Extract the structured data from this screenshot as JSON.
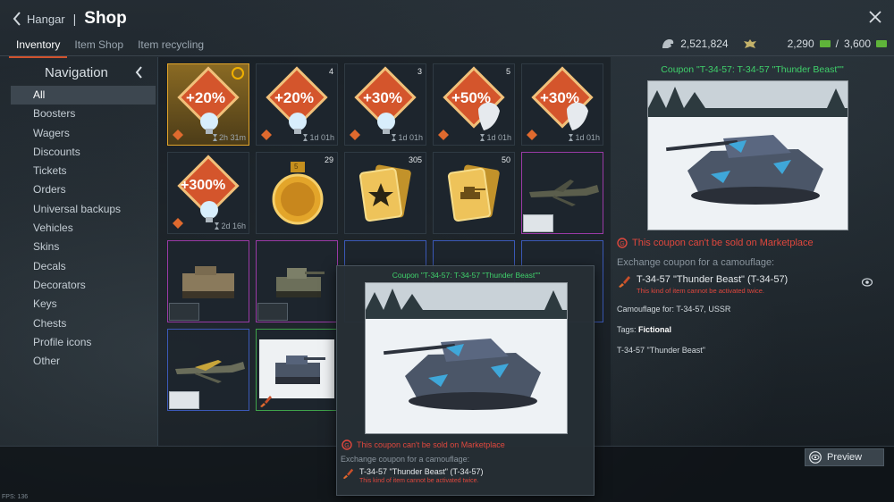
{
  "header": {
    "back_label": "Hangar",
    "separator": "|",
    "title": "Shop",
    "tabs": [
      "Inventory",
      "Item Shop",
      "Item recycling"
    ],
    "active_tab": "Inventory",
    "currency": {
      "silver_lions": "2,521,824",
      "golden_eagles": "2,290",
      "ge_sep": "/",
      "ge_total": "3,600"
    }
  },
  "nav": {
    "title": "Navigation",
    "items": [
      "All",
      "Boosters",
      "Wagers",
      "Discounts",
      "Tickets",
      "Orders",
      "Universal backups",
      "Vehicles",
      "Skins",
      "Decals",
      "Decorators",
      "Keys",
      "Chests",
      "Profile icons",
      "Other"
    ],
    "active": "All"
  },
  "grid": {
    "cells": [
      {
        "kind": "booster",
        "label": "+20%",
        "timer": "2h 31m",
        "count": ""
      },
      {
        "kind": "booster",
        "label": "+20%",
        "timer": "1d 01h",
        "count": "4"
      },
      {
        "kind": "booster",
        "label": "+30%",
        "timer": "1d 01h",
        "count": "3"
      },
      {
        "kind": "booster",
        "label": "+50%",
        "timer": "1d 01h",
        "count": "5"
      },
      {
        "kind": "booster",
        "label": "+30%",
        "timer": "1d 01h",
        "count": ""
      },
      {
        "kind": "booster",
        "label": "+300%",
        "timer": "2d 16h",
        "count": ""
      },
      {
        "kind": "medal",
        "label": "",
        "timer": "",
        "count": "29",
        "medal_number": "5"
      },
      {
        "kind": "card-star",
        "label": "",
        "timer": "",
        "count": "305"
      },
      {
        "kind": "card-tank",
        "label": "",
        "timer": "",
        "count": "50"
      },
      {
        "kind": "plane",
        "label": "",
        "timer": "",
        "count": ""
      },
      {
        "kind": "tank-apc",
        "label": "",
        "timer": "",
        "count": ""
      },
      {
        "kind": "tank-light",
        "label": "",
        "timer": "",
        "count": ""
      },
      {
        "kind": "empty",
        "label": "",
        "timer": "",
        "count": ""
      },
      {
        "kind": "empty",
        "label": "",
        "timer": "",
        "count": ""
      },
      {
        "kind": "empty",
        "label": "",
        "timer": "",
        "count": ""
      },
      {
        "kind": "plane2",
        "label": "",
        "timer": "",
        "count": ""
      },
      {
        "kind": "coupon",
        "label": "",
        "timer": "",
        "count": ""
      }
    ]
  },
  "detail": {
    "title": "Coupon \"T-34-57: T-34-57 \"Thunder Beast\"\"",
    "warning": "This coupon can't be sold on Marketplace",
    "exchange": "Exchange coupon for a camouflage:",
    "item_name": "T-34-57 \"Thunder Beast\" (T-34-57)",
    "item_note": "This kind of item cannot be activated twice.",
    "camo_for": "Camouflage for: T-34-57, USSR",
    "tags_label": "Tags: ",
    "tags_value": "Fictional",
    "footer_name": "T-34-57 \"Thunder Beast\""
  },
  "tooltip": {
    "title": "Coupon \"T-34-57: T-34-57 \"Thunder Beast\"\"",
    "warning": "This coupon can't be sold on Marketplace",
    "exchange": "Exchange coupon for a camouflage:",
    "item_name": "T-34-57 \"Thunder Beast\" (T-34-57)",
    "item_note": "This kind of item cannot be activated twice."
  },
  "footer": {
    "preview_label": "Preview",
    "fps": "FPS: 136"
  },
  "colors": {
    "accent_orange": "#d0532e",
    "green_title": "#3fd16b",
    "warning_red": "#e0473d",
    "gold_border": "#e2a52a",
    "purple_border": "#9a3aa6",
    "blue_border": "#3b59b8",
    "green_border": "#3fa34a"
  }
}
